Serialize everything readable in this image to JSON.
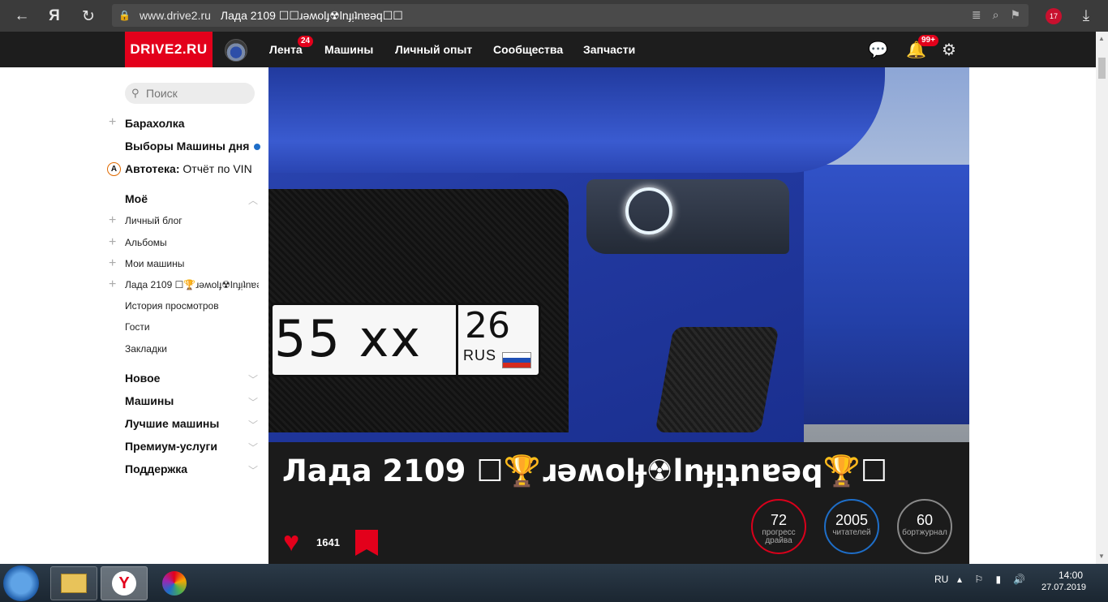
{
  "browser": {
    "domain": "www.drive2.ru",
    "page_title": "Лада 2109 ☐☐ɹǝʍolɟ☢lnɟᴉʇnɐǝq☐☐",
    "yandex_glyph": "Я",
    "downloads_badge": "17"
  },
  "header": {
    "logo": "DRIVE2.RU",
    "nav": [
      {
        "label": "Лента",
        "badge": "24"
      },
      {
        "label": "Машины"
      },
      {
        "label": "Личный опыт"
      },
      {
        "label": "Сообщества"
      },
      {
        "label": "Запчасти"
      }
    ],
    "notifications_badge": "99+"
  },
  "sidebar": {
    "search_placeholder": "Поиск",
    "top_items": [
      "Барахолка",
      "Выборы Машины дня"
    ],
    "avtoteka_label": "Автотека:",
    "avtoteka_link": "Отчёт по VIN",
    "avtoteka_icon": "А",
    "my_section": "Моё",
    "my_items": [
      "Личный блог",
      "Альбомы",
      "Мои машины",
      "Лада 2109 ☐🏆ɹǝʍolɟ☢lnɟᴉʇnɐǝq…",
      "История просмотров",
      "Гости",
      "Закладки"
    ],
    "sections": [
      "Новое",
      "Машины",
      "Лучшие машины",
      "Премиум-услуги",
      "Поддержка"
    ]
  },
  "plate": {
    "number": "55 xx",
    "region": "26",
    "country": "RUS"
  },
  "car": {
    "title": "Лада 2109 ☐🏆ɹǝʍolɟ☢lnɟᴉʇnɐǝq🏆☐",
    "likes": "1641",
    "stats": [
      {
        "value": "72",
        "label": "прогресс драйва",
        "color": "#d9001b"
      },
      {
        "value": "2005",
        "label": "читателей",
        "color": "#1e6ec8"
      },
      {
        "value": "60",
        "label": "бортжурнал",
        "color": "#8a8a8a"
      }
    ]
  },
  "taskbar": {
    "lang": "RU",
    "time": "14:00",
    "date": "27.07.2019"
  },
  "colors": {
    "brand": "#e3001b",
    "header_bg": "#1d1d1d",
    "panel_bg": "#1b1b1b",
    "accent_blue": "#1e6ec8"
  }
}
